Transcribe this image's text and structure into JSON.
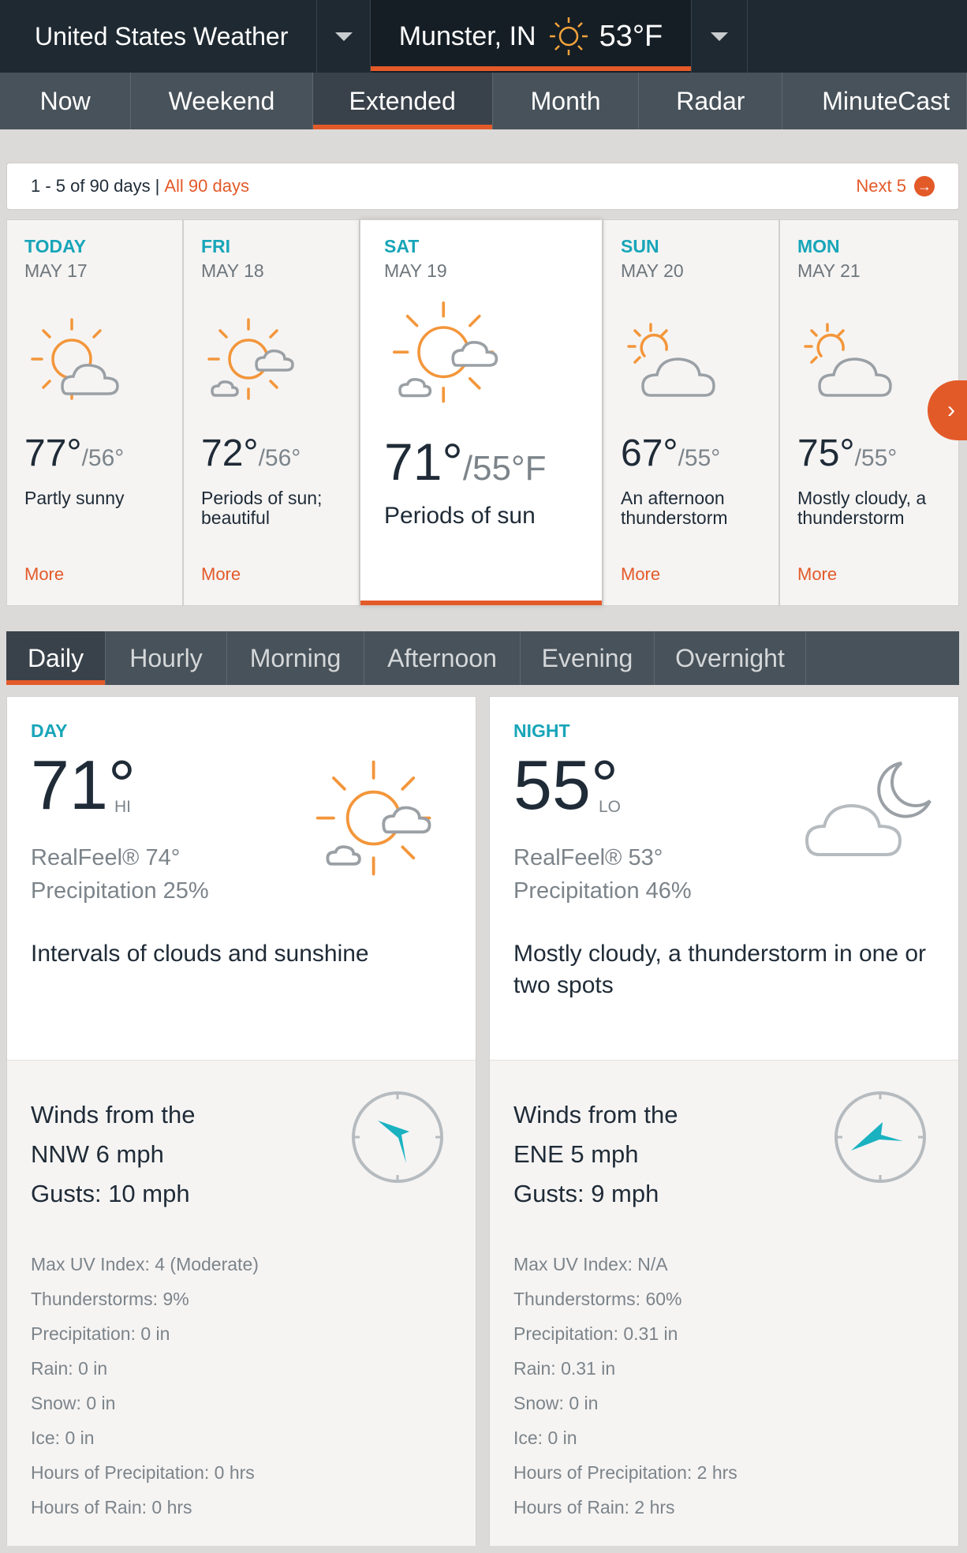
{
  "topbar": {
    "title": "United States Weather",
    "location": "Munster, IN",
    "current_temp": "53°F",
    "current_icon": "sun-icon"
  },
  "nav_tabs": [
    "Now",
    "Weekend",
    "Extended",
    "Month",
    "Radar",
    "MinuteCast"
  ],
  "nav_active": "Extended",
  "pager": {
    "count": "1 - 5 of 90 days",
    "separator": "|",
    "all": "All 90 days",
    "next": "Next 5"
  },
  "days": [
    {
      "name": "TODAY",
      "date": "MAY 17",
      "hi": "77°",
      "lo": "/56°",
      "desc": "Partly sunny",
      "more": "More",
      "icon": "partly-sunny-icon"
    },
    {
      "name": "FRI",
      "date": "MAY 18",
      "hi": "72°",
      "lo": "/56°",
      "desc": "Periods of sun; beautiful",
      "more": "More",
      "icon": "sun-clouds-icon"
    },
    {
      "name": "SAT",
      "date": "MAY 19",
      "hi": "71°",
      "lo": "/55°F",
      "desc": "Periods of sun",
      "more": "",
      "icon": "sun-clouds-icon"
    },
    {
      "name": "SUN",
      "date": "MAY 20",
      "hi": "67°",
      "lo": "/55°",
      "desc": "An afternoon thunderstorm",
      "more": "More",
      "icon": "mostly-cloudy-icon"
    },
    {
      "name": "MON",
      "date": "MAY 21",
      "hi": "75°",
      "lo": "/55°",
      "desc": "Mostly cloudy, a thunderstorm",
      "more": "More",
      "icon": "mostly-cloudy-icon"
    }
  ],
  "sub_tabs": [
    "Daily",
    "Hourly",
    "Morning",
    "Afternoon",
    "Evening",
    "Overnight"
  ],
  "sub_active": "Daily",
  "day_panel": {
    "label": "DAY",
    "temp": "71°",
    "hilo": "HI",
    "realfeel": "RealFeel® 74°",
    "precip": "Precipitation 25%",
    "desc": "Intervals of clouds and sunshine",
    "wind1": "Winds from the",
    "wind2": "NNW 6 mph",
    "gusts": "Gusts: 10 mph",
    "stats": [
      "Max UV Index: 4 (Moderate)",
      "Thunderstorms: 9%",
      "Precipitation: 0 in",
      "Rain: 0 in",
      "Snow: 0 in",
      "Ice: 0 in",
      "Hours of Precipitation: 0 hrs",
      "Hours of Rain: 0 hrs"
    ]
  },
  "night_panel": {
    "label": "NIGHT",
    "temp": "55°",
    "hilo": "LO",
    "realfeel": "RealFeel® 53°",
    "precip": "Precipitation 46%",
    "desc": "Mostly cloudy, a thunderstorm in one or two spots",
    "wind1": "Winds from the",
    "wind2": "ENE 5 mph",
    "gusts": "Gusts: 9 mph",
    "stats": [
      "Max UV Index: N/A",
      "Thunderstorms: 60%",
      "Precipitation: 0.31 in",
      "Rain: 0.31 in",
      "Snow: 0 in",
      "Ice: 0 in",
      "Hours of Precipitation: 2 hrs",
      "Hours of Rain: 2 hrs"
    ]
  },
  "colors": {
    "accent": "#e35a29",
    "teal": "#17a5b8",
    "dark": "#1f2931"
  }
}
